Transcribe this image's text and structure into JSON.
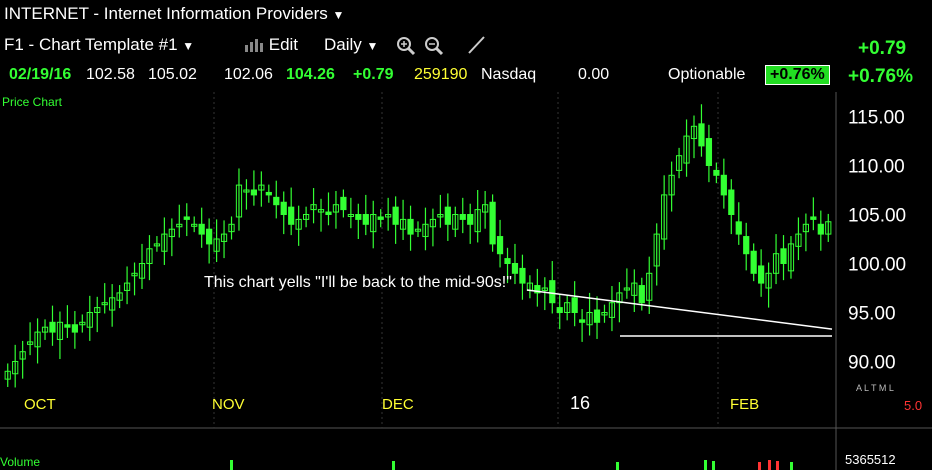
{
  "header": {
    "title": "INTERNET - Internet Information Providers",
    "template": "F1 - Chart Template #1",
    "edit_label": "Edit",
    "interval": "Daily",
    "change_top": "+0.79",
    "change_pct": "+0.76%"
  },
  "quote": {
    "date": "02/19/16",
    "open": "102.58",
    "high": "105.02",
    "low": "102.06",
    "close": "104.26",
    "change": "+0.79",
    "volume": "259190",
    "exchange": "Nasdaq",
    "extra": "0.00",
    "optionable": "Optionable",
    "badge": "+0.76%"
  },
  "panel": {
    "price_label": "Price Chart",
    "volume_label": "Volume",
    "volume_value": "5365512",
    "scale_letters": "A L T M L",
    "scale_value": "5.0"
  },
  "colors": {
    "background": "#000000",
    "candle": "#33ff33",
    "axis_text": "#ffffff",
    "month_labels": "#ffff33",
    "annotation_line": "#ffffff",
    "grid": "#333333"
  },
  "chart_data": {
    "type": "candlestick",
    "title": "",
    "xlabel": "",
    "ylabel": "",
    "ylim": [
      87.5,
      117.5
    ],
    "y_ticks": [
      "115.00",
      "110.00",
      "105.00",
      "100.00",
      "95.00",
      "90.00"
    ],
    "x_ticks": [
      "OCT",
      "NOV",
      "DEC",
      "16",
      "FEB"
    ],
    "grid": true,
    "annotation": "This chart yells \"I'll be back to the mid-90s!\"",
    "approx_closes": [
      89,
      90,
      91,
      92,
      93,
      93.5,
      93,
      94,
      93.5,
      93,
      94,
      95,
      95.5,
      96,
      96.5,
      97,
      98,
      99,
      100,
      101.5,
      102,
      103,
      103.5,
      104,
      104.5,
      104,
      103,
      102,
      102.5,
      103,
      104,
      108,
      107.5,
      107,
      108,
      107,
      106,
      105,
      104,
      104.5,
      105,
      106,
      105.5,
      105,
      106,
      105.5,
      105,
      104.5,
      104,
      105,
      104.5,
      105,
      104,
      104.5,
      103,
      103.5,
      104,
      104.5,
      105,
      104,
      105,
      104.5,
      104,
      105.5,
      106,
      102,
      101,
      100,
      99,
      98,
      98,
      97,
      97.5,
      96,
      95,
      96,
      95,
      94,
      95,
      94,
      95,
      96,
      97,
      97.5,
      98,
      96,
      99,
      103,
      107,
      109,
      111,
      113,
      114,
      112,
      110,
      109,
      107,
      105,
      103,
      101,
      99,
      98,
      99,
      101,
      100,
      102,
      103,
      104,
      104.5,
      103,
      104.26
    ]
  }
}
